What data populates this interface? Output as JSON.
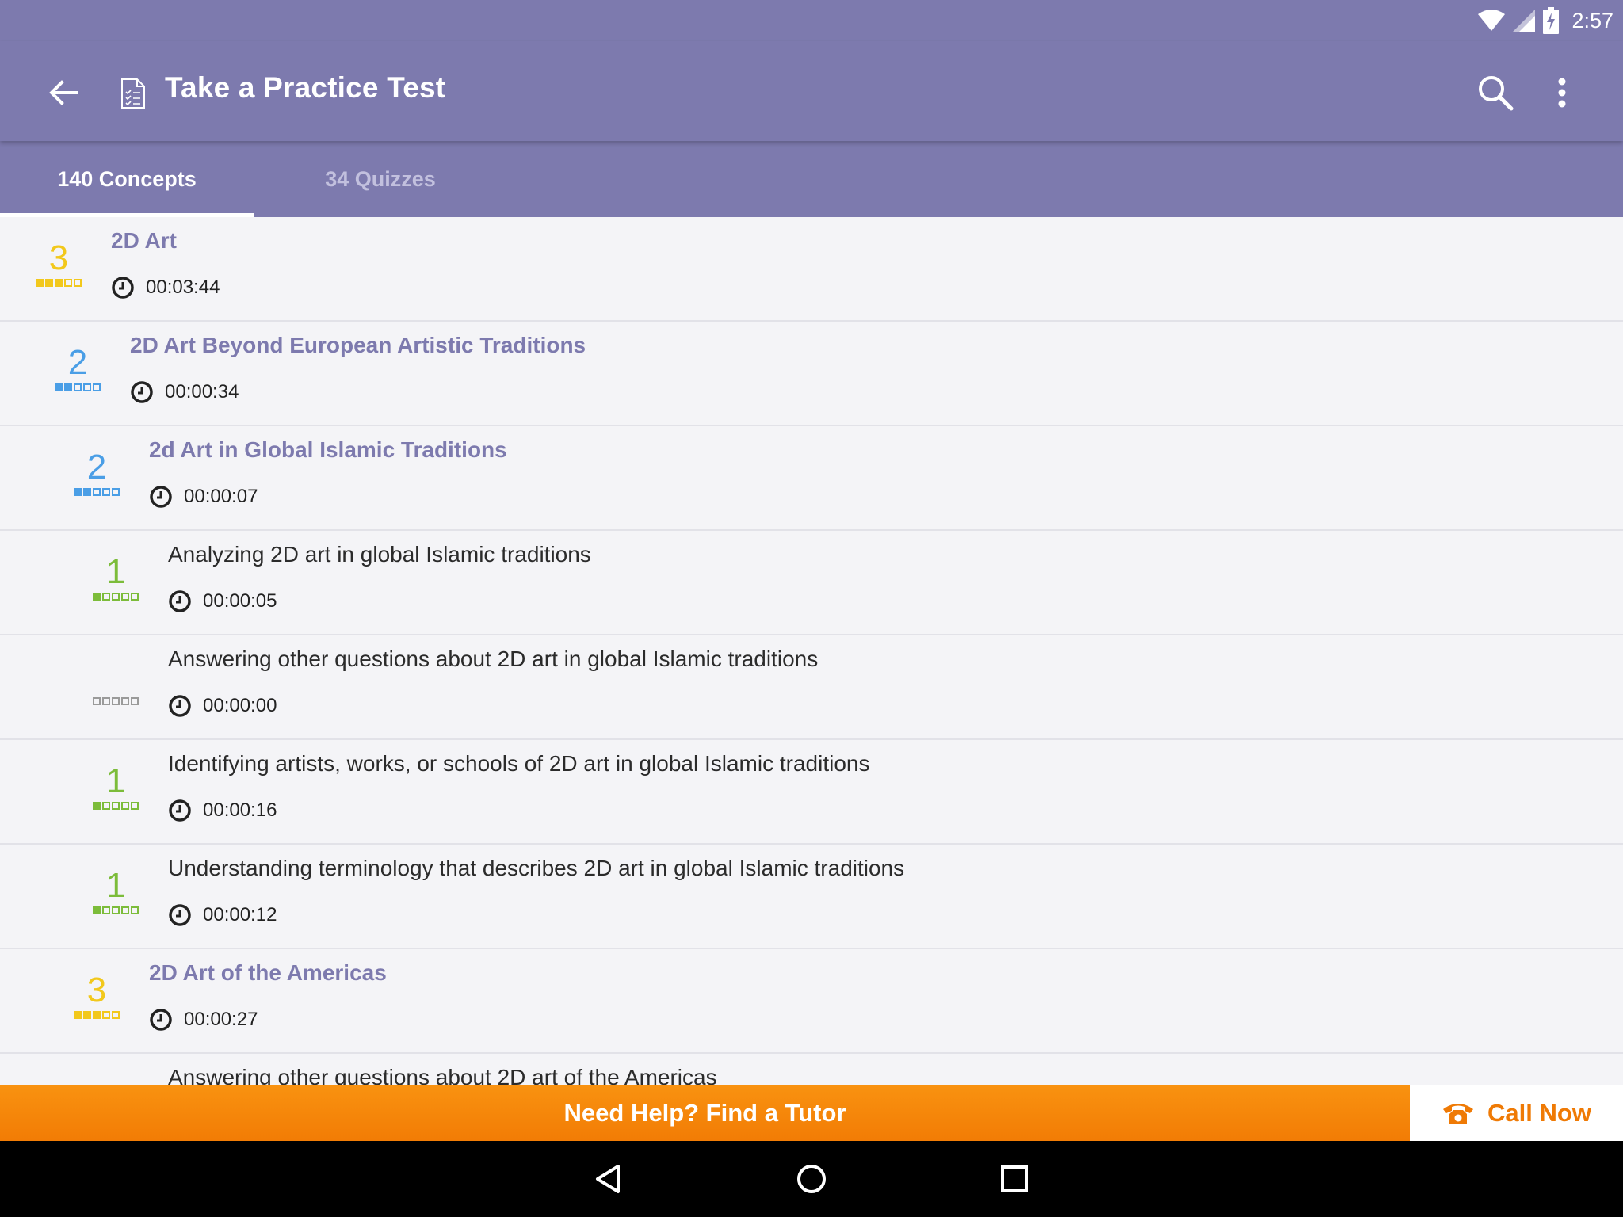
{
  "status": {
    "time": "2:57"
  },
  "app": {
    "title": "Take a Practice Test"
  },
  "tabs": [
    {
      "label": "140 Concepts",
      "active": true
    },
    {
      "label": "34 Quizzes",
      "active": false
    }
  ],
  "colors": {
    "primary": "#7d7aae",
    "level_3": "#f2c81c",
    "level_2": "#4a9ee6",
    "level_1": "#7cbc3a",
    "level_0": "#9a9a9a",
    "accent": "#f58a0b"
  },
  "concepts": [
    {
      "title": "2D Art",
      "time": "00:03:44",
      "level": "3",
      "mastery": 3,
      "type": "group",
      "indent": 0
    },
    {
      "title": "2D Art Beyond European Artistic Traditions",
      "time": "00:00:34",
      "level": "2",
      "mastery": 2,
      "type": "group",
      "indent": 1
    },
    {
      "title": "2d Art in Global Islamic Traditions",
      "time": "00:00:07",
      "level": "2",
      "mastery": 2,
      "type": "group",
      "indent": 2
    },
    {
      "title": "Analyzing 2D art in global Islamic traditions",
      "time": "00:00:05",
      "level": "1",
      "mastery": 1,
      "type": "item",
      "indent": 3
    },
    {
      "title": "Answering other questions about 2D art in global Islamic traditions",
      "time": "00:00:00",
      "level": "",
      "mastery": 0,
      "type": "item",
      "indent": 3
    },
    {
      "title": "Identifying artists, works, or schools of 2D art in global Islamic traditions",
      "time": "00:00:16",
      "level": "1",
      "mastery": 1,
      "type": "item",
      "indent": 3
    },
    {
      "title": "Understanding terminology that describes 2D art in global Islamic traditions",
      "time": "00:00:12",
      "level": "1",
      "mastery": 1,
      "type": "item",
      "indent": 3
    },
    {
      "title": "2D Art of the Americas",
      "time": "00:00:27",
      "level": "3",
      "mastery": 3,
      "type": "group",
      "indent": 2
    },
    {
      "title": "Answering other questions about 2D art of the Americas",
      "time": "",
      "level": "",
      "mastery": -1,
      "type": "item",
      "indent": 3
    }
  ],
  "banner": {
    "help_label": "Need Help? Find a Tutor",
    "call_label": "Call Now"
  },
  "icons": {
    "back": "back-arrow-icon",
    "doc": "document-checklist-icon",
    "search": "search-icon",
    "more": "more-vert-icon",
    "clock": "clock-icon",
    "phone": "phone-icon",
    "wifi": "wifi-icon",
    "signal": "signal-icon",
    "battery": "battery-charging-icon"
  }
}
